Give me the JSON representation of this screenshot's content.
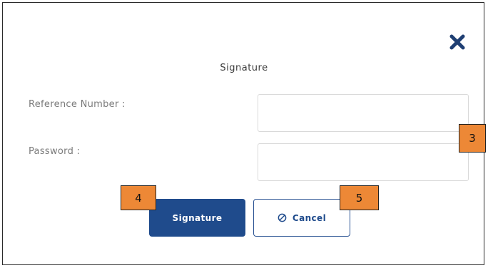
{
  "dialog": {
    "title": "Signature",
    "close_icon": "close-icon"
  },
  "form": {
    "reference_label": "Reference Number :",
    "reference_value": "",
    "password_label": "Password :",
    "password_value": ""
  },
  "buttons": {
    "signature_label": "Signature",
    "cancel_label": "Cancel",
    "cancel_icon": "cancel-icon"
  },
  "annotations": [
    "3",
    "4",
    "5"
  ],
  "colors": {
    "primary": "#1f4b8c",
    "close_icon": "#1f3f73",
    "badge": "#ed8836"
  }
}
